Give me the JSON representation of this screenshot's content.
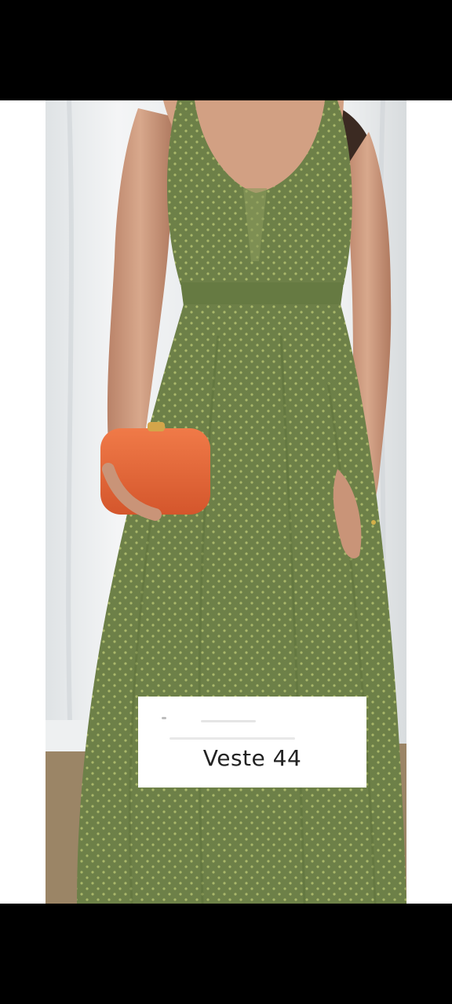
{
  "caption": {
    "label": "Veste 44"
  },
  "colors": {
    "background_curtain": "#e9ecee",
    "dress": "#6d8048",
    "dress_dots": "#aab86a",
    "clutch": "#e8683a",
    "skin": "#c99478",
    "hair": "#3b2a22",
    "floor": "#9b8566"
  }
}
